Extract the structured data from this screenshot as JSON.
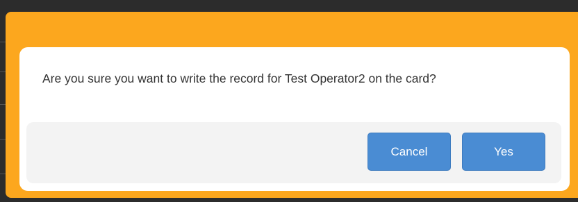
{
  "dialog": {
    "message": "Are you sure you want to write the record for Test Operator2 on the card?",
    "cancel_label": "Cancel",
    "yes_label": "Yes"
  },
  "colors": {
    "frame": "#FCA71E",
    "button": "#4A8CD3",
    "footer": "#F3F3F3"
  }
}
